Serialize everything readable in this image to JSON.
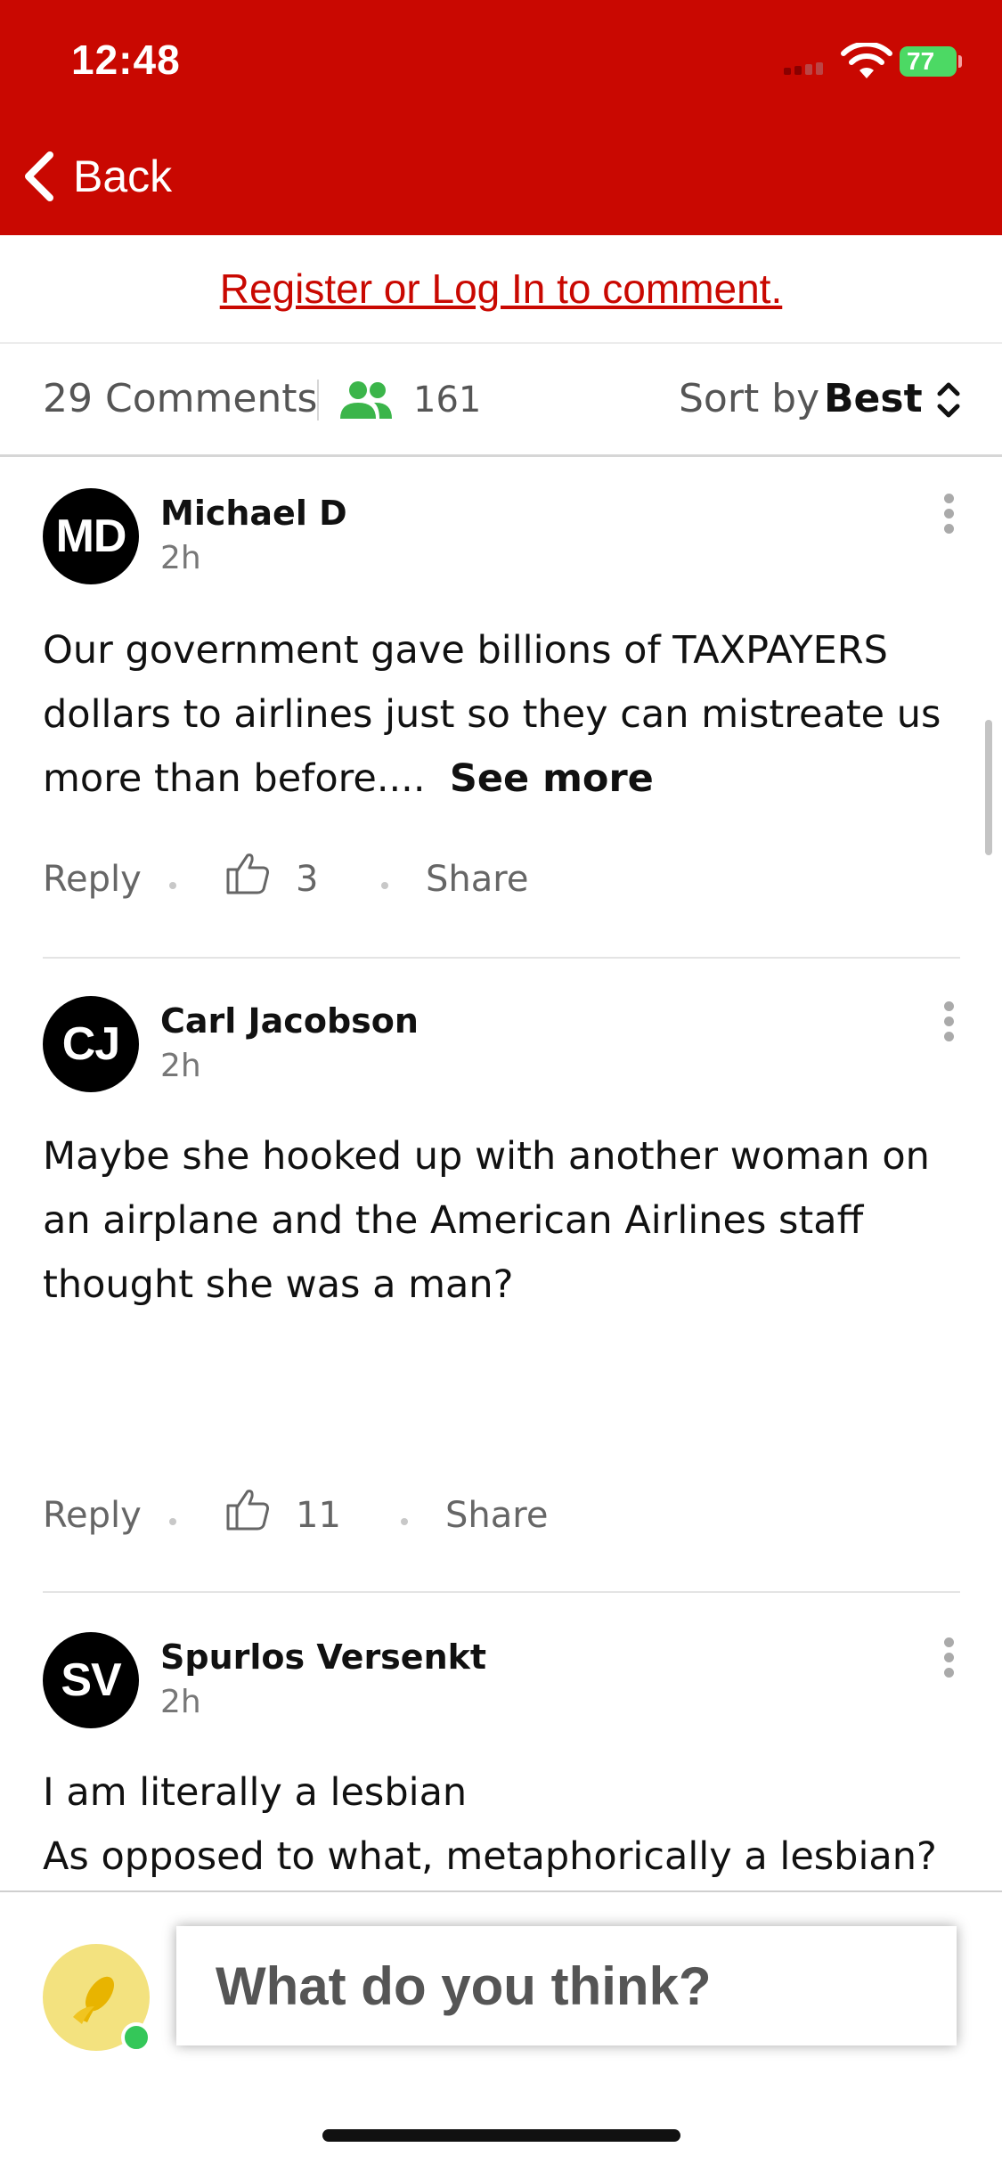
{
  "status_bar": {
    "time": "12:48",
    "battery": "77"
  },
  "nav": {
    "back_label": "Back"
  },
  "register": {
    "link_text": "Register or Log In to comment."
  },
  "meta": {
    "comments_count": "29 Comments",
    "viewers": "161",
    "sort_label": "Sort by",
    "sort_value": "Best"
  },
  "comments": [
    {
      "initials": "MD",
      "author": "Michael D",
      "time": "2h",
      "text": "Our government gave billions of TAXPAYERS dollars to airlines just so they can mistreate us more than before....",
      "see_more": "See more",
      "reply": "Reply",
      "likes": "3",
      "share": "Share"
    },
    {
      "initials": "CJ",
      "author": "Carl Jacobson",
      "time": "2h",
      "text": "Maybe she hooked up with another woman on an airplane and the American Airlines staff thought she was a man?",
      "reply": "Reply",
      "likes": "11",
      "share": "Share"
    },
    {
      "initials": "SV",
      "author": "Spurlos Versenkt",
      "time": "2h",
      "text_line1": "I am literally a lesbian",
      "text_line2": "As opposed to what, metaphorically a lesbian?"
    }
  ],
  "composer": {
    "placeholder": "What do you think?"
  },
  "colors": {
    "brand_red": "#c90801",
    "online_green": "#34c759",
    "viewers_green": "#3bb54a"
  },
  "icons": [
    "back-chevron-icon",
    "wifi-icon",
    "battery-icon",
    "people-icon",
    "sort-chevrons-icon",
    "more-options-icon",
    "thumbs-up-icon",
    "corn-icon"
  ]
}
